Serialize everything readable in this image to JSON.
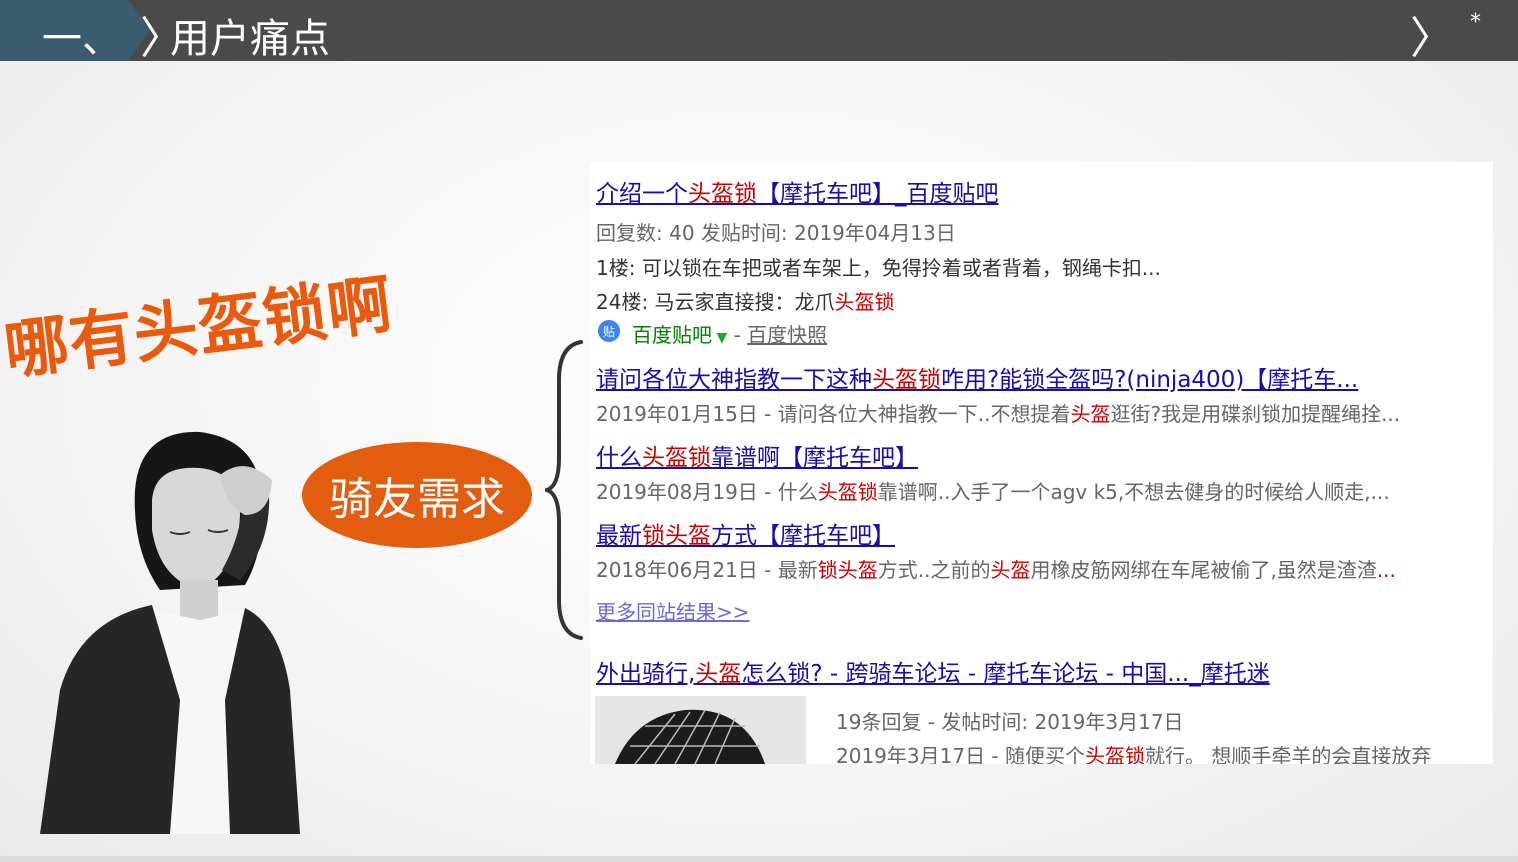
{
  "header": {
    "number": "一、",
    "title": "用户痛点",
    "star": "*"
  },
  "left": {
    "shout": "哪有头盔锁啊",
    "bubble": "骑友需求"
  },
  "results": {
    "r1_title_a": "介绍一个",
    "r1_title_hl": "头盔锁",
    "r1_title_b": "【摩托车吧】_百度贴吧",
    "r1_meta": "回复数: 40 发贴时间: 2019年04月13日",
    "r1_line1": "1楼: 可以锁在车把或者车架上，免得拎着或者背着，钢绳卡扣...",
    "r1_line2_a": "24楼: 马云家直接搜：龙爪",
    "r1_line2_hl": "头盔锁",
    "r1_source": "百度贴吧",
    "r1_source_sep": " - ",
    "r1_cache": "百度快照",
    "r2_title_a": "请问各位大神指教一下这种",
    "r2_title_hl": "头盔锁",
    "r2_title_b": "咋用?能锁全盔吗?(ninja400)【摩托车...",
    "r2_desc_a": "2019年01月15日 - 请问各位大神指教一下..不想提着",
    "r2_desc_hl": "头盔",
    "r2_desc_b": "逛街?我是用碟刹锁加提醒绳拴...",
    "r3_title_a": "什么",
    "r3_title_hl": "头盔锁",
    "r3_title_b": "靠谱啊【摩托车吧】",
    "r3_desc_a": "2019年08月19日 - 什么",
    "r3_desc_hl": "头盔锁",
    "r3_desc_b": "靠谱啊..入手了一个agv k5,不想去健身的时候给人顺走,...",
    "r4_title_a": "最新",
    "r4_title_hl": "锁头盔",
    "r4_title_b": "方式【摩托车吧】",
    "r4_desc_a": "2018年06月21日 - 最新",
    "r4_desc_hl1": "锁头盔",
    "r4_desc_b": "方式..之前的",
    "r4_desc_hl2": "头盔",
    "r4_desc_c": "用橡皮筋网绑在车尾被偷了,虽然是渣渣",
    "r4_desc_dots": "...",
    "more": "更多同站结果>>",
    "r5_title_a": "外出骑行,",
    "r5_title_hl": "头盔",
    "r5_title_b": "怎么锁? - 跨骑车论坛 - 摩托车论坛 - 中国..._摩托迷",
    "r5_meta": "19条回复 - 发帖时间: 2019年3月17日",
    "r5_desc_a": "2019年3月17日 - 随便买个",
    "r5_desc_hl": "头盔锁",
    "r5_desc_b": "就行。 想顺手牵羊的会直接放弃"
  },
  "colors": {
    "header_bg": "#4a4a4a",
    "tab_bg": "#3b5b6e",
    "accent_orange": "#e35d10",
    "link_blue": "#1a0dab",
    "highlight_red": "#cc0000"
  }
}
